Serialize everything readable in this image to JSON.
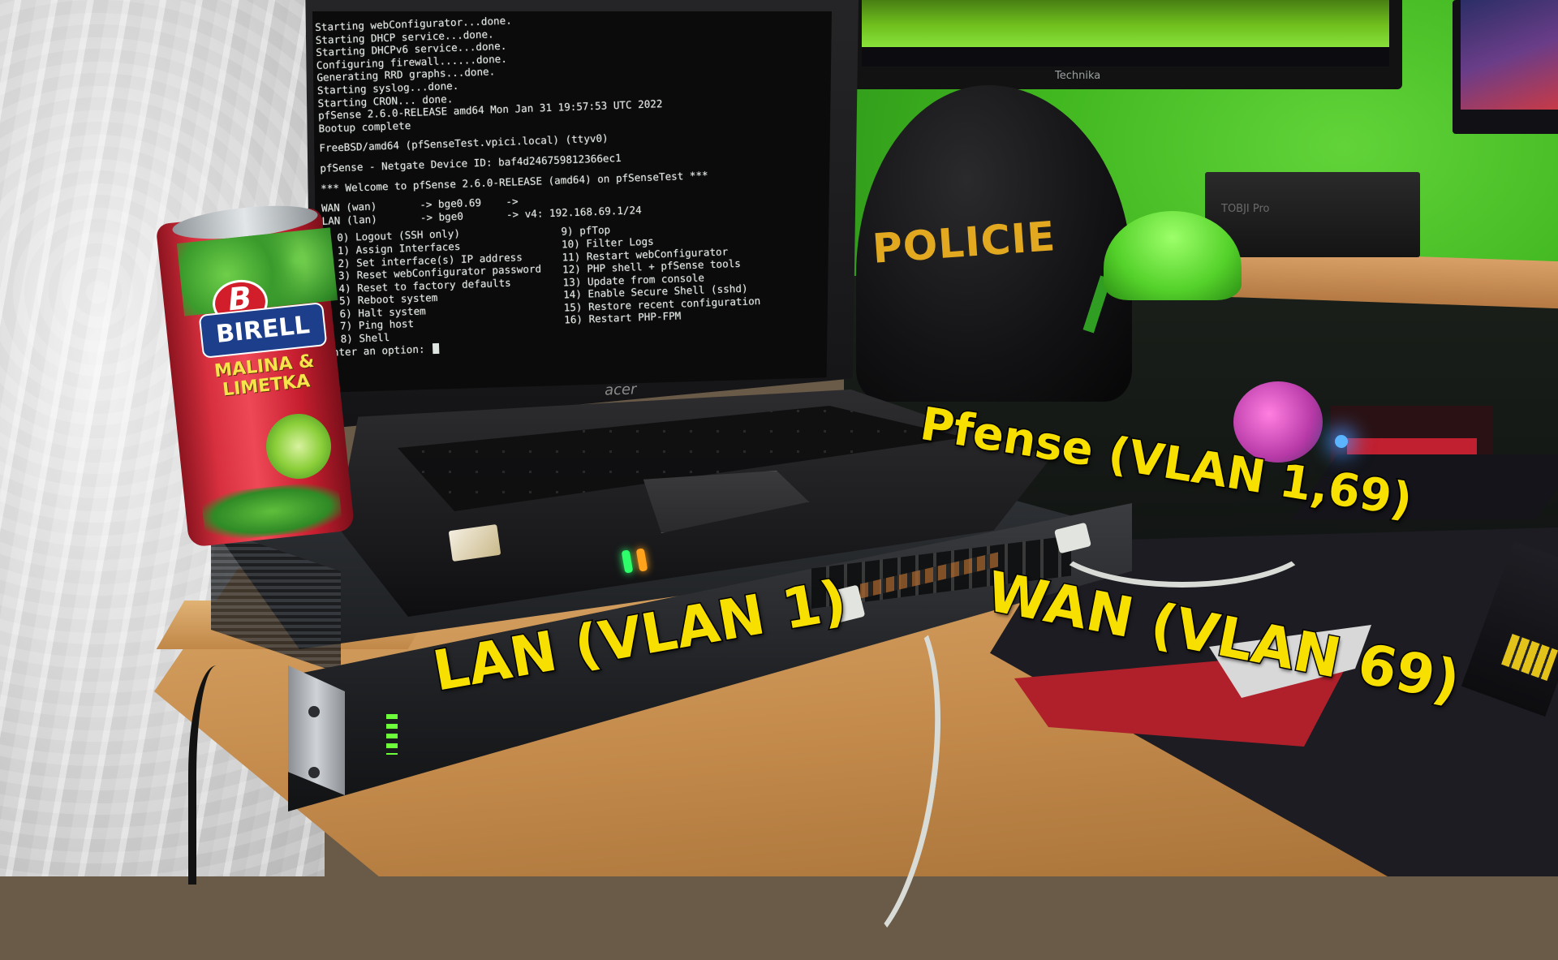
{
  "terminal": {
    "boot_lines": [
      "Starting webConfigurator...done.",
      "Starting DHCP service...done.",
      "Starting DHCPv6 service...done.",
      "Configuring firewall......done.",
      "Generating RRD graphs...done.",
      "Starting syslog...done.",
      "Starting CRON... done.",
      "pfSense 2.6.0-RELEASE amd64 Mon Jan 31 19:57:53 UTC 2022",
      "Bootup complete"
    ],
    "console_line": "FreeBSD/amd64 (pfSenseTest.vpici.local) (ttyv0)",
    "device_id_line": "pfSense - Netgate Device ID: baf4d246759812366ec1",
    "welcome_line": "*** Welcome to pfSense 2.6.0-RELEASE (amd64) on pfSenseTest ***",
    "interface_lines": [
      "WAN (wan)       -> bge0.69    ->",
      "LAN (lan)       -> bge0       -> v4: 192.168.69.1/24"
    ],
    "menu_left": [
      "0) Logout (SSH only)",
      "1) Assign Interfaces",
      "2) Set interface(s) IP address",
      "3) Reset webConfigurator password",
      "4) Reset to factory defaults",
      "5) Reboot system",
      "6) Halt system",
      "7) Ping host",
      "8) Shell"
    ],
    "menu_right": [
      "9) pfTop",
      "10) Filter Logs",
      "11) Restart webConfigurator",
      "12) PHP shell + pfSense tools",
      "13) Update from console",
      "14) Enable Secure Shell (sshd)",
      "15) Restore recent configuration",
      "16) Restart PHP-FPM"
    ],
    "prompt": "Enter an option:"
  },
  "laptop": {
    "brand": "acer"
  },
  "cap": {
    "text": "POLICIE"
  },
  "can": {
    "badge_letter": "B",
    "brand": "BIRELL",
    "flavor_line1": "MALINA &",
    "flavor_line2": "LIMETKA"
  },
  "monitor": {
    "brand": "Technika"
  },
  "shelf_box": {
    "label": "TOBJI Pro"
  },
  "annotations": {
    "pfense": "Pfense (VLAN 1,69)",
    "wan": "WAN (VLAN 69)",
    "lan": "LAN (VLAN 1)"
  },
  "colors": {
    "annotation_fill": "#f7e000",
    "annotation_outline": "#000000",
    "terminal_text": "#dfe5e0",
    "cap_text": "#e1a820",
    "wall": "#3fb51e"
  }
}
